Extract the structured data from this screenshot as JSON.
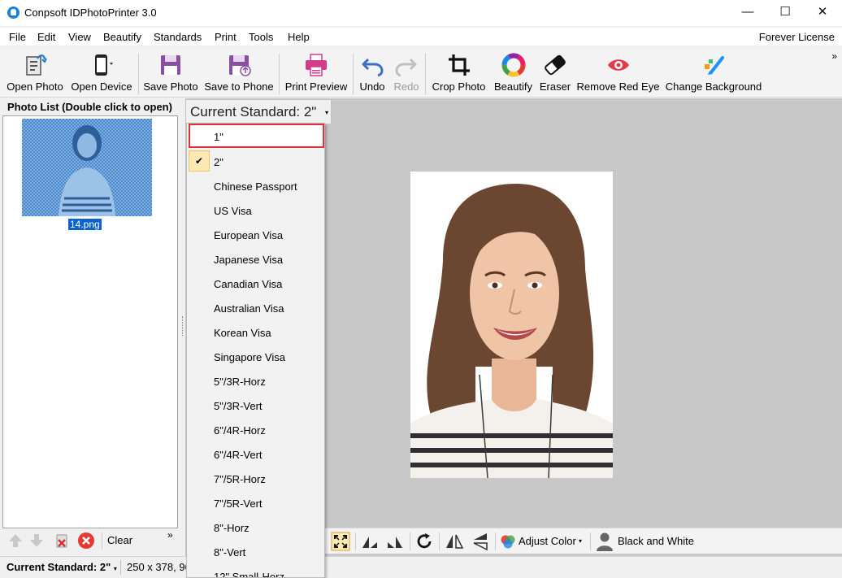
{
  "window": {
    "title": "Conpsoft IDPhotoPrinter 3.0",
    "minimize_glyph": "—",
    "maximize_glyph": "☐",
    "close_glyph": "✕"
  },
  "menu": {
    "items": [
      "File",
      "Edit",
      "View",
      "Beautify",
      "Standards",
      "Print",
      "Tools",
      "Help"
    ],
    "license": "Forever License"
  },
  "toolbar": {
    "open_photo": "Open Photo",
    "open_device": "Open Device",
    "save_photo": "Save Photo",
    "save_to_phone": "Save to Phone",
    "print_preview": "Print Preview",
    "undo": "Undo",
    "redo": "Redo",
    "crop_photo": "Crop Photo",
    "beautify": "Beautify",
    "eraser": "Eraser",
    "remove_red_eye": "Remove Red Eye",
    "change_background": "Change Background",
    "more": "»"
  },
  "photo_list": {
    "title": "Photo List (Double click to open)",
    "items": [
      {
        "name": "14.png",
        "selected": true
      }
    ],
    "clear_label": "Clear",
    "more": "»"
  },
  "current_standard": {
    "label": "Current Standard: 2\"",
    "caret": "▾"
  },
  "standards_menu": {
    "items": [
      "1\"",
      "2\"",
      "Chinese Passport",
      "US Visa",
      "European Visa",
      "Japanese Visa",
      "Canadian Visa",
      "Australian Visa",
      "Korean Visa",
      "Singapore Visa",
      "5\"/3R-Horz",
      "5\"/3R-Vert",
      "6\"/4R-Horz",
      "6\"/4R-Vert",
      "7\"/5R-Horz",
      "7\"/5R-Vert",
      "8\"-Horz",
      "8\"-Vert",
      "12\" Small-Horz"
    ],
    "checked": "2\"",
    "highlighted": "1\"",
    "check_glyph": "✔"
  },
  "bottom_tools": {
    "adjust_color": "Adjust Color",
    "black_and_white": "Black and White"
  },
  "status": {
    "standard": "Current Standard: 2\"",
    "size": "250 x 378, 96"
  },
  "colors": {
    "accent": "#1a7fd8",
    "selection": "#0a64d0",
    "highlight_border": "#e0303a",
    "canvas": "#c8c8c8"
  }
}
